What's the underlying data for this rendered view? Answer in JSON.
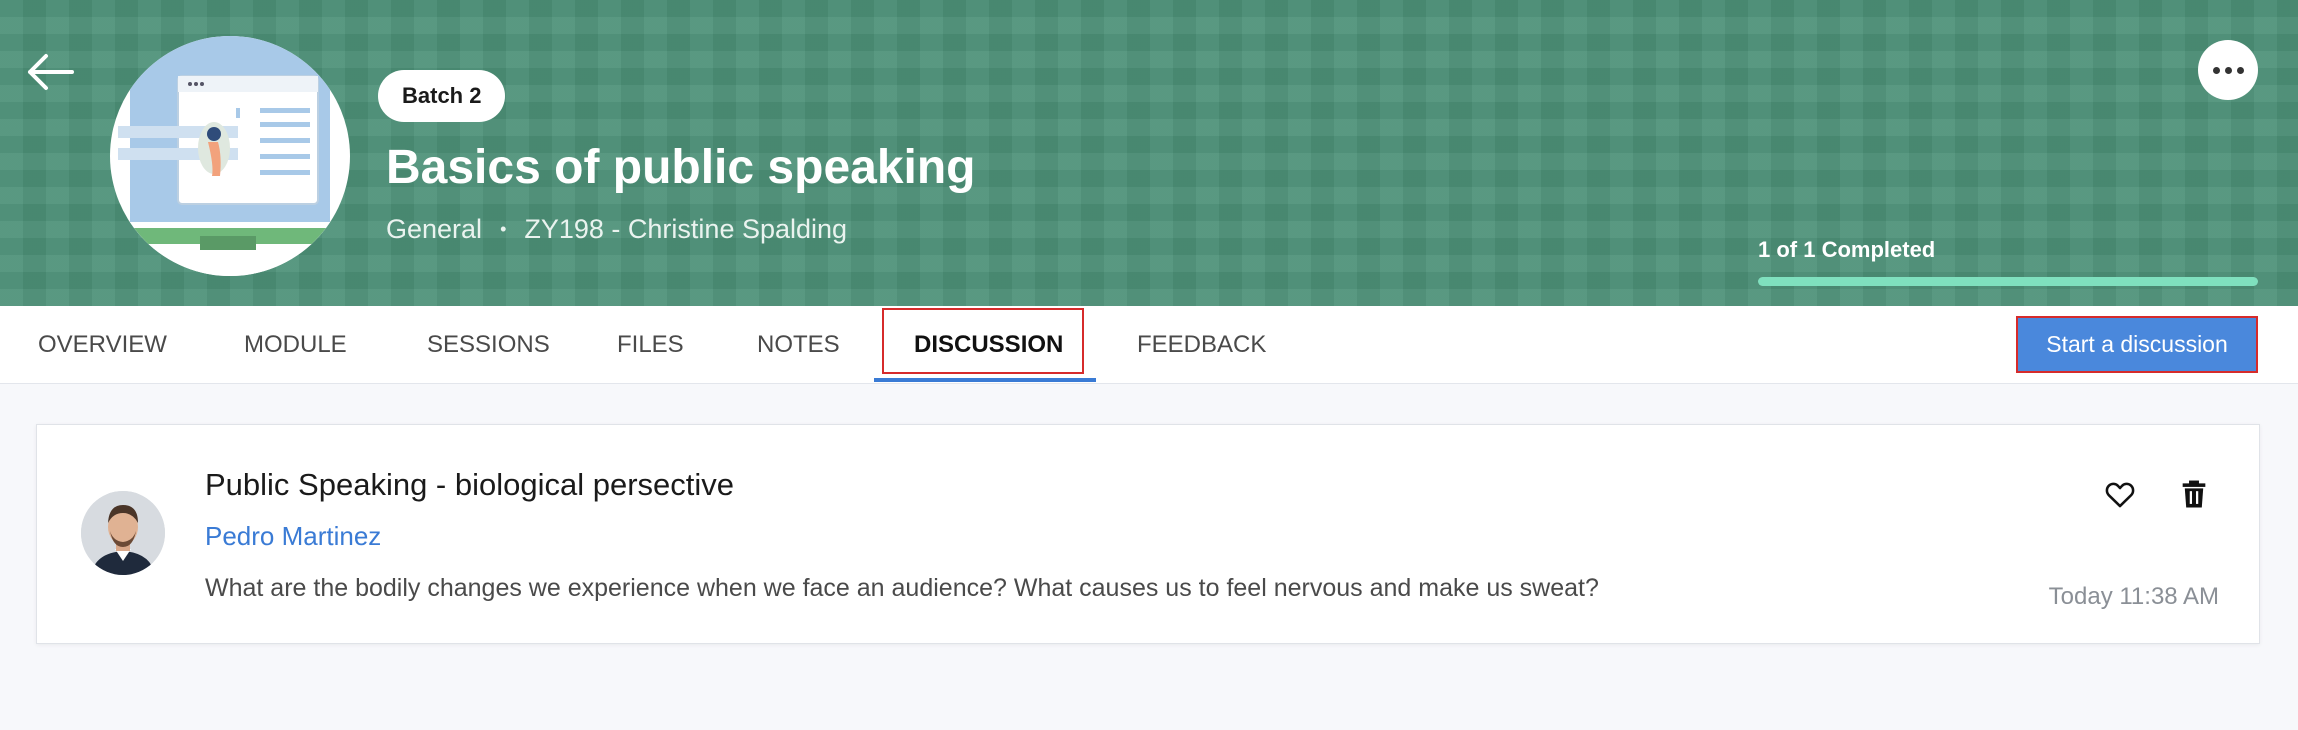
{
  "header": {
    "batch_label": "Batch 2",
    "title": "Basics of public speaking",
    "category": "General",
    "separator": "•",
    "course_code_instructor": "ZY198 - Christine Spalding",
    "progress_text": "1 of 1 Completed",
    "progress_fraction": 1.0,
    "icons": {
      "back": "arrow-left-icon",
      "more": "more-horizontal-icon"
    }
  },
  "tabs": [
    {
      "label": "OVERVIEW",
      "active": false
    },
    {
      "label": "MODULE",
      "active": false
    },
    {
      "label": "SESSIONS",
      "active": false
    },
    {
      "label": "FILES",
      "active": false
    },
    {
      "label": "NOTES",
      "active": false
    },
    {
      "label": "DISCUSSION",
      "active": true
    },
    {
      "label": "FEEDBACK",
      "active": false
    }
  ],
  "actions": {
    "start_discussion_label": "Start a discussion"
  },
  "discussion": {
    "title": "Public Speaking - biological persective",
    "author": "Pedro Martinez",
    "body": "What are the bodily changes we experience when we face an audience? What causes us to feel nervous and make us sweat?",
    "timestamp": "Today 11:38 AM",
    "icons": {
      "like": "heart-icon",
      "delete": "trash-icon"
    }
  },
  "colors": {
    "banner": "#4d9178",
    "accent": "#4a88dc",
    "link": "#3a7bd5",
    "highlight_box": "#d62b2b",
    "progress_fill": "#7fe0be"
  }
}
